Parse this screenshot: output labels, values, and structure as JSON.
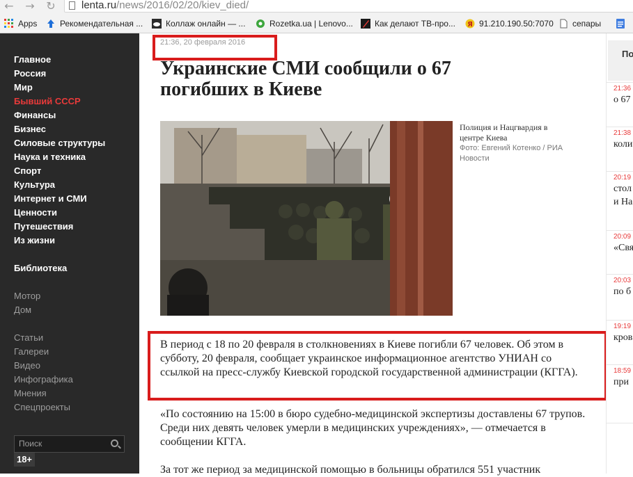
{
  "browser": {
    "url_host": "lenta.ru",
    "url_path": "/news/2016/02/20/kiev_died/",
    "bookmarks": [
      {
        "label": "Apps",
        "icon": "apps-grid-icon"
      },
      {
        "label": "Рекомендательная ...",
        "icon": "upload-arrow-icon"
      },
      {
        "label": "Коллаж онлайн — ...",
        "icon": "cloud-icon"
      },
      {
        "label": "Rozetka.ua | Lenovo...",
        "icon": "rozetka-icon"
      },
      {
        "label": "Как делают ТВ-про...",
        "icon": "pen-icon"
      },
      {
        "label": "91.210.190.50:7070",
        "icon": "yandex-icon"
      },
      {
        "label": "сепары",
        "icon": "page-icon"
      }
    ]
  },
  "sidebar": {
    "items": [
      "Главное",
      "Россия",
      "Мир",
      "Бывший СССР",
      "Финансы",
      "Бизнес",
      "Силовые структуры",
      "Наука и техника",
      "Спорт",
      "Культура",
      "Интернет и СМИ",
      "Ценности",
      "Путешествия",
      "Из жизни"
    ],
    "active": "Бывший СССР",
    "library": "Библиотека",
    "partners": [
      "Мотор",
      "Дом"
    ],
    "sections": [
      "Статьи",
      "Галереи",
      "Видео",
      "Инфографика",
      "Мнения",
      "Спецпроекты"
    ],
    "search_placeholder": "Поиск",
    "age_rating": "18+"
  },
  "article": {
    "timestamp": "21:36, 20 февраля 2016",
    "title": "Украинские СМИ сообщили о 67 погибших в Киеве",
    "photo_caption": "Полиция и Нацгвардия в центре Киева",
    "photo_credit": "Фото: Евгений Котенко / РИА Новости",
    "paragraphs": [
      "В период с 18 по 20 февраля в столкновениях в Киеве погибли 67 человек. Об этом в субботу, 20 февраля, сообщает украинское информационное агентство УНИАН со ссылкой на пресс-службу Киевской городской государственной администрации (КГГА).",
      "«По состоянию на 15:00 в бюро судебно-медицинской экспертизы доставлены 67 трупов. Среди них девять человек умерли в медицинских учреждениях», — отмечается в сообщении КГГА.",
      "За тот же период за медицинской помощью в больницы обратился 551 участник"
    ]
  },
  "right_column": {
    "header": "По",
    "items": [
      {
        "time": "21:36",
        "text": "о 67"
      },
      {
        "time": "21:38",
        "text": "коли"
      },
      {
        "time": "20:19",
        "text": "стол"
      },
      {
        "time": "20:09",
        "text": "«Свя"
      },
      {
        "time": "20:03",
        "text": "по б"
      },
      {
        "time": "19:19",
        "text": "кров"
      },
      {
        "time": "18:59",
        "text": "при"
      }
    ],
    "extra_line": "и На"
  },
  "colors": {
    "accent": "#e83a3a",
    "sidebar_bg": "#292929",
    "highlight": "#d91c1c"
  }
}
